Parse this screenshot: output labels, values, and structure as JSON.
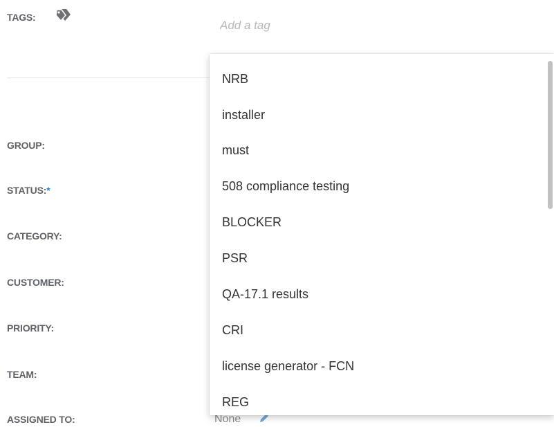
{
  "tags": {
    "label": "TAGS:",
    "icon": "tags-icon",
    "placeholder": "Add a tag"
  },
  "fields": {
    "group": "GROUP:",
    "status": "STATUS:",
    "status_required": "*",
    "category": "CATEGORY:",
    "customer": "CUSTOMER:",
    "priority": "PRIORITY:",
    "team": "TEAM:",
    "assigned_to": "ASSIGNED TO:",
    "assigned_to_value": "None"
  },
  "dropdown": {
    "options": [
      "NRB",
      "installer",
      "must",
      "508 compliance testing",
      "BLOCKER",
      "PSR",
      "QA-17.1 results",
      "CRI",
      "license generator - FCN",
      "REG"
    ]
  },
  "colors": {
    "label": "#5f6368",
    "accent": "#2a84c9",
    "option_text": "#333333",
    "placeholder": "#b4b8bd"
  }
}
